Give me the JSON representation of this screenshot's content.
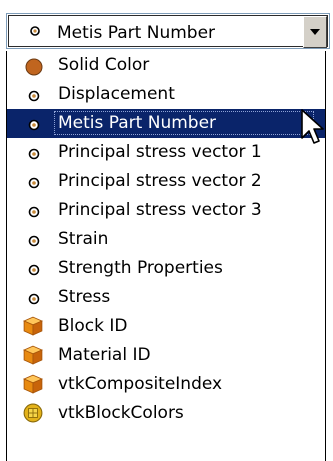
{
  "combo": {
    "selected_label": "Metis Part Number",
    "icon": "point-data-icon"
  },
  "list": {
    "items": [
      {
        "label": "Solid Color",
        "icon": "solid-color-icon"
      },
      {
        "label": "Displacement",
        "icon": "point-data-icon"
      },
      {
        "label": "Metis Part Number",
        "icon": "point-data-icon",
        "selected": true
      },
      {
        "label": "Principal stress vector 1",
        "icon": "point-data-icon"
      },
      {
        "label": "Principal stress vector 2",
        "icon": "point-data-icon"
      },
      {
        "label": "Principal stress vector 3",
        "icon": "point-data-icon"
      },
      {
        "label": "Strain",
        "icon": "point-data-icon"
      },
      {
        "label": "Strength Properties",
        "icon": "point-data-icon"
      },
      {
        "label": "Stress",
        "icon": "point-data-icon"
      },
      {
        "label": "Block ID",
        "icon": "field-data-block-icon"
      },
      {
        "label": "Material ID",
        "icon": "field-data-block-icon"
      },
      {
        "label": "vtkCompositeIndex",
        "icon": "field-data-block-icon"
      },
      {
        "label": "vtkBlockColors",
        "icon": "field-data-cell-icon"
      }
    ]
  },
  "colors": {
    "selection": "#0a246a",
    "solid_color": "#c0651f",
    "block_icon": "#e88a10"
  }
}
